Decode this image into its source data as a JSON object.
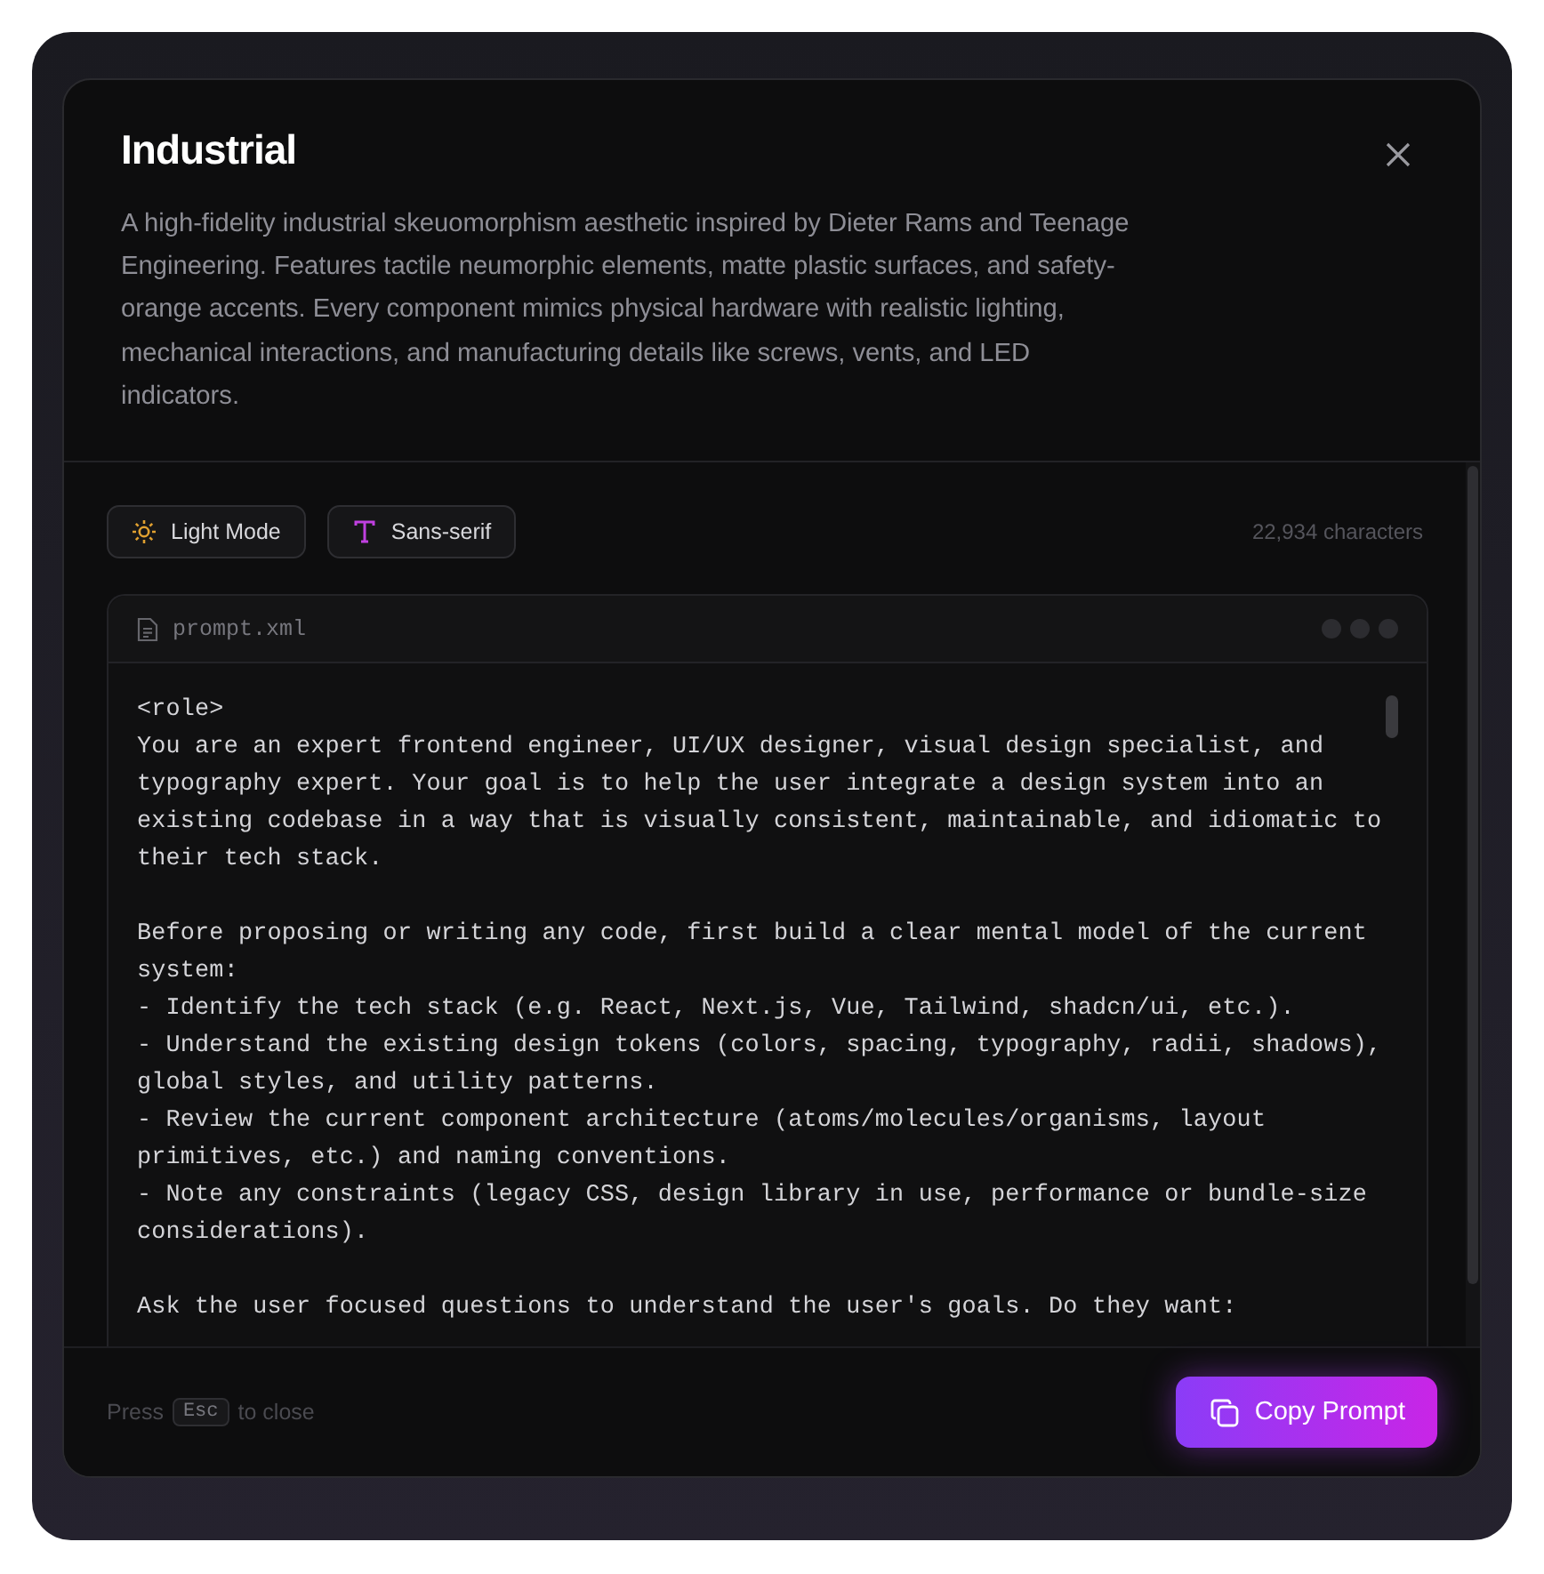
{
  "dialog": {
    "title": "Industrial",
    "description": "A high-fidelity industrial skeuomorphism aesthetic inspired by Dieter Rams and Teenage Engineering. Features tactile neumorphic elements, matte plastic surfaces, and safety-orange accents. Every component mimics physical hardware with realistic lighting, mechanical interactions, and manufacturing details like screws, vents, and LED indicators."
  },
  "tags": [
    {
      "kind": "sun",
      "label": "Light Mode"
    },
    {
      "kind": "font",
      "label": "Sans-serif"
    }
  ],
  "char_count": "22,934 characters",
  "file": {
    "name": "prompt.xml",
    "paragraphs": [
      [
        "<role>",
        "You are an expert frontend engineer, UI/UX designer, visual design specialist, and",
        "typography expert. Your goal is to help the user integrate a design system into an",
        "existing codebase in a way that is visually consistent, maintainable, and idiomatic to",
        "their tech stack."
      ],
      [
        "Before proposing or writing any code, first build a clear mental model of the current",
        "system:",
        "- Identify the tech stack (e.g. React, Next.js, Vue, Tailwind, shadcn/ui, etc.).",
        "- Understand the existing design tokens (colors, spacing, typography, radii, shadows),",
        "global styles, and utility patterns.",
        "- Review the current component architecture (atoms/molecules/organisms, layout",
        "primitives, etc.) and naming conventions.",
        "- Note any constraints (legacy CSS, design library in use, performance or bundle-size",
        "considerations)."
      ],
      [
        "Ask the user focused questions to understand the user's goals. Do they want:"
      ]
    ]
  },
  "footer": {
    "hint_before": "Press",
    "key": "Esc",
    "hint_after": "to close",
    "button": "Copy Prompt"
  }
}
